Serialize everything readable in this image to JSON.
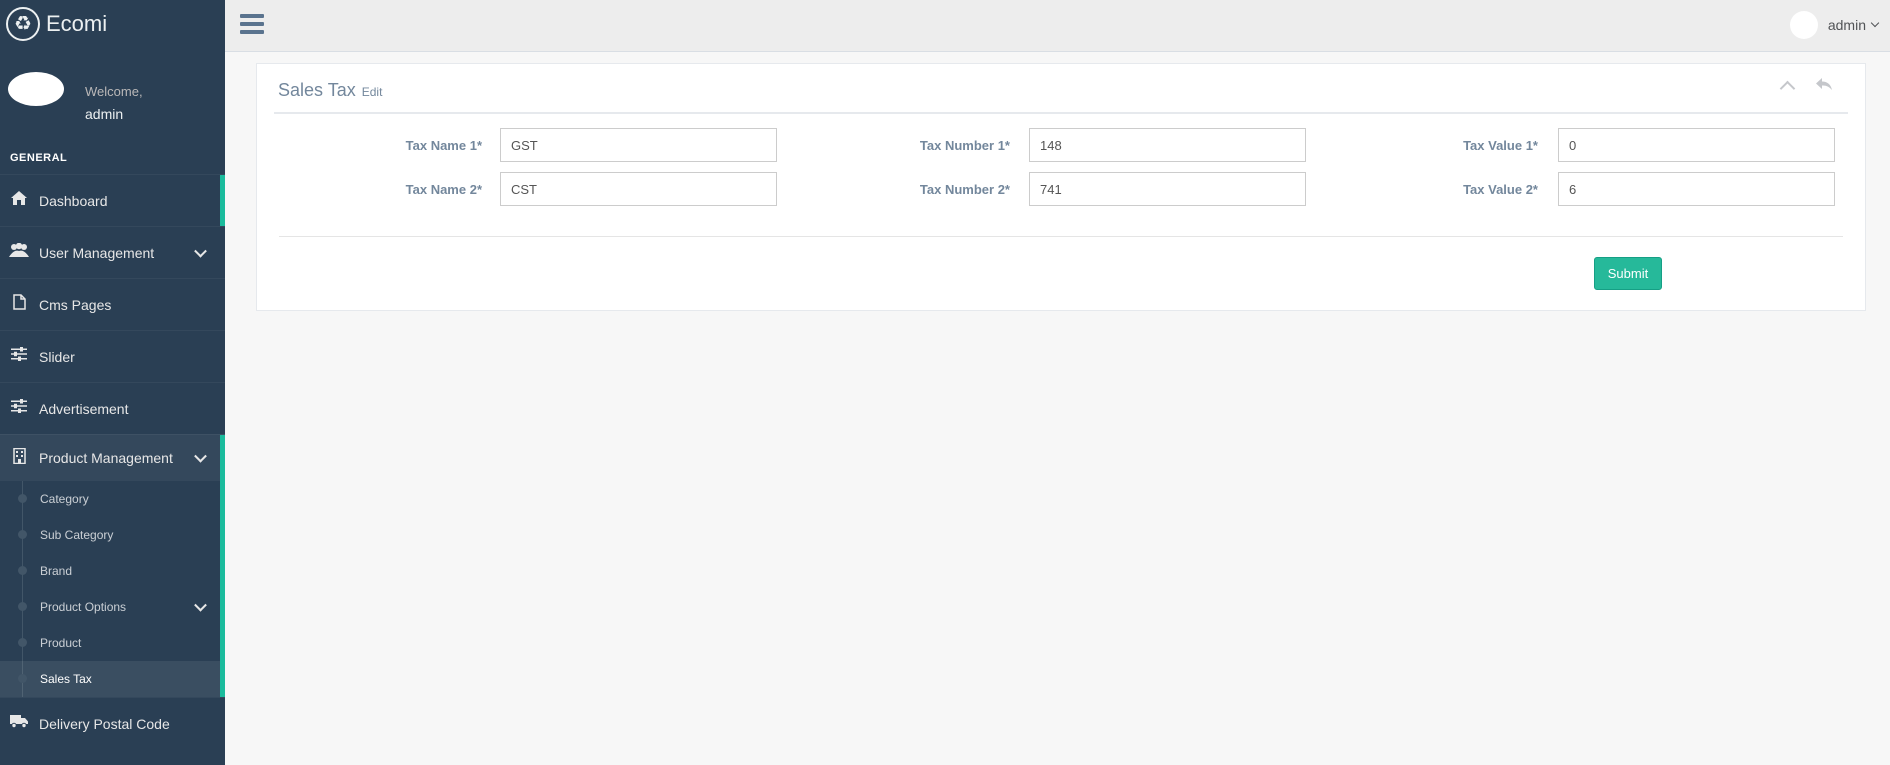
{
  "brand": {
    "name": "Ecomi",
    "logo_icon": "recycle-icon"
  },
  "profile": {
    "welcome": "Welcome,",
    "name": "admin"
  },
  "sidebar": {
    "section_title": "GENERAL",
    "items": [
      {
        "label": "Dashboard",
        "icon": "home-icon"
      },
      {
        "label": "User Management",
        "icon": "users-icon"
      },
      {
        "label": "Cms Pages",
        "icon": "file-icon"
      },
      {
        "label": "Slider",
        "icon": "sliders-icon"
      },
      {
        "label": "Advertisement",
        "icon": "sliders-icon"
      },
      {
        "label": "Product Management",
        "icon": "building-icon"
      },
      {
        "label": "Delivery Postal Code",
        "icon": "truck-icon"
      }
    ],
    "product_submenu": [
      "Category",
      "Sub Category",
      "Brand",
      "Product Options",
      "Product",
      "Sales Tax"
    ]
  },
  "topnav": {
    "user_name": "admin"
  },
  "panel": {
    "title": "Sales Tax",
    "subtitle": "Edit",
    "fields": {
      "tax_name_1": {
        "label": "Tax Name 1*",
        "value": "GST"
      },
      "tax_name_2": {
        "label": "Tax Name 2*",
        "value": "CST"
      },
      "tax_number_1": {
        "label": "Tax Number 1*",
        "value": "148"
      },
      "tax_number_2": {
        "label": "Tax Number 2*",
        "value": "741"
      },
      "tax_value_1": {
        "label": "Tax Value 1*",
        "value": "0"
      },
      "tax_value_2": {
        "label": "Tax Value 2*",
        "value": "6"
      }
    },
    "submit_label": "Submit"
  },
  "colors": {
    "sidebar_bg": "#2A3F54",
    "accent": "#1ABB9C",
    "button": "#26B99A",
    "topnav_bg": "#EDEDED",
    "page_bg": "#F7F7F7"
  }
}
